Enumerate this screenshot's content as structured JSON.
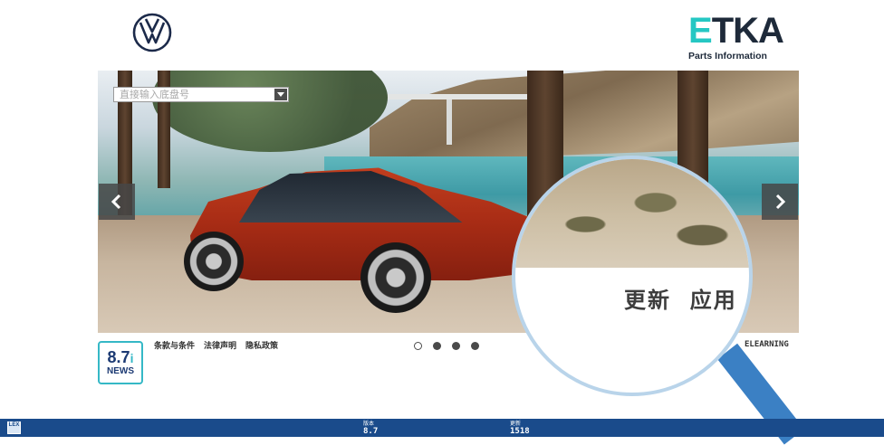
{
  "header": {
    "vw_logo": "vw-logo",
    "etka_logo": "ETKA",
    "etka_subtitle": "Parts Information"
  },
  "search": {
    "placeholder": "直接输入底盘号"
  },
  "carousel": {
    "prev_icon": "chevron-left-icon",
    "next_icon": "chevron-right-icon",
    "slide_count": 4,
    "active_index": 0
  },
  "magnifier": {
    "text_update": "更新",
    "text_app": "应用"
  },
  "footer": {
    "links": [
      "条款与条件",
      "法律声明",
      "隐私政策"
    ],
    "elearning": "ELEARNING",
    "news_version": "8.7",
    "news_label": "NEWS"
  },
  "status_bar": {
    "app_icon": "LEX",
    "version_label": "版本",
    "version_value": "8.7",
    "update_label": "更新",
    "update_value": "1518"
  },
  "colors": {
    "accent_teal": "#25c7c3",
    "status_bar_blue": "#1a4b8b",
    "magnifier_handle": "#3b80c4"
  }
}
